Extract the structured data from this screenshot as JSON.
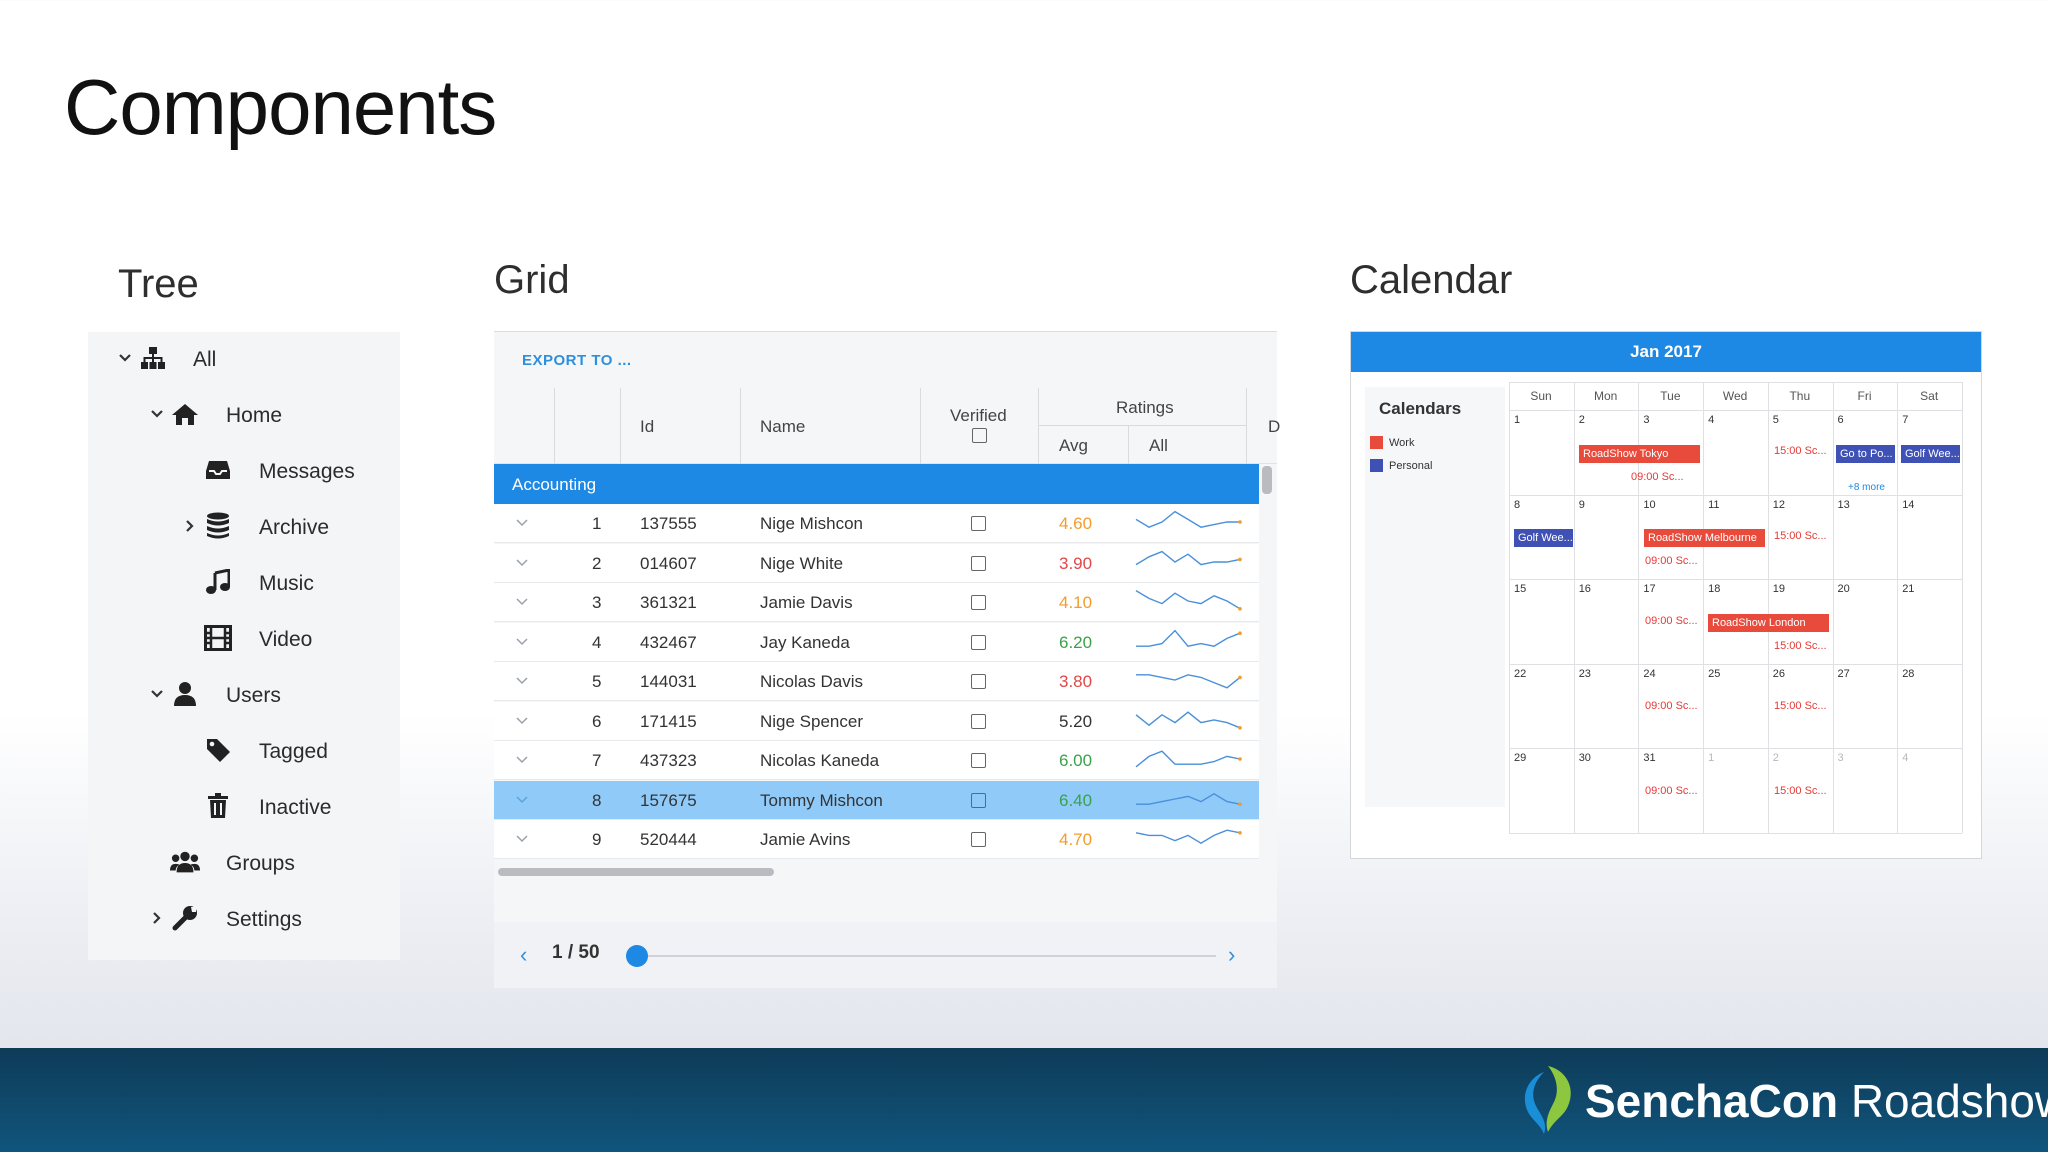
{
  "slide": {
    "title": "Components"
  },
  "sections": {
    "tree": "Tree",
    "grid": "Grid",
    "calendar": "Calendar"
  },
  "tree": {
    "nodes": [
      {
        "label": "All",
        "icon": "sitemap-icon",
        "expanded": true,
        "level": 0
      },
      {
        "label": "Home",
        "icon": "home-icon",
        "expanded": true,
        "level": 1
      },
      {
        "label": "Messages",
        "icon": "inbox-icon",
        "level": 2
      },
      {
        "label": "Archive",
        "icon": "database-icon",
        "collapsed": true,
        "level": 2
      },
      {
        "label": "Music",
        "icon": "music-icon",
        "level": 2
      },
      {
        "label": "Video",
        "icon": "film-icon",
        "level": 2
      },
      {
        "label": "Users",
        "icon": "user-icon",
        "expanded": true,
        "level": 1
      },
      {
        "label": "Tagged",
        "icon": "tag-icon",
        "level": 2
      },
      {
        "label": "Inactive",
        "icon": "trash-icon",
        "level": 2
      },
      {
        "label": "Groups",
        "icon": "users-icon",
        "level": 1
      },
      {
        "label": "Settings",
        "icon": "wrench-icon",
        "collapsed": true,
        "level": 1
      }
    ]
  },
  "grid": {
    "export_label": "EXPORT TO ...",
    "columns": {
      "id": "Id",
      "name": "Name",
      "verified": "Verified",
      "ratings": "Ratings",
      "avg": "Avg",
      "all": "All",
      "d": "D"
    },
    "group_label": "Accounting",
    "rows": [
      {
        "n": "1",
        "id": "137555",
        "name": "Nige Mishcon",
        "avg": "4.60",
        "color": "#f39c2b",
        "spark": [
          6,
          3,
          5,
          9,
          6,
          3,
          4,
          5,
          5
        ]
      },
      {
        "n": "2",
        "id": "014607",
        "name": "Nige White",
        "avg": "3.90",
        "color": "#e04848",
        "spark": [
          4,
          7,
          9,
          5,
          8,
          4,
          5,
          5,
          6
        ]
      },
      {
        "n": "3",
        "id": "361321",
        "name": "Jamie Davis",
        "avg": "4.10",
        "color": "#f39c2b",
        "spark": [
          9,
          6,
          4,
          8,
          5,
          4,
          7,
          5,
          2
        ]
      },
      {
        "n": "4",
        "id": "432467",
        "name": "Jay Kaneda",
        "avg": "6.20",
        "color": "#3aa248",
        "spark": [
          3,
          3,
          4,
          9,
          3,
          4,
          3,
          6,
          8
        ]
      },
      {
        "n": "5",
        "id": "144031",
        "name": "Nicolas Davis",
        "avg": "3.80",
        "color": "#e04848",
        "spark": [
          7,
          7,
          6,
          5,
          7,
          6,
          4,
          2,
          6
        ]
      },
      {
        "n": "6",
        "id": "171415",
        "name": "Nige Spencer",
        "avg": "5.20",
        "color": "#333333",
        "spark": [
          7,
          3,
          7,
          4,
          8,
          4,
          5,
          4,
          2
        ]
      },
      {
        "n": "7",
        "id": "437323",
        "name": "Nicolas Kaneda",
        "avg": "6.00",
        "color": "#3aa248",
        "spark": [
          2,
          6,
          8,
          3,
          3,
          3,
          4,
          6,
          5
        ]
      },
      {
        "n": "8",
        "id": "157675",
        "name": "Tommy Mishcon",
        "avg": "6.40",
        "color": "#3aa248",
        "selected": true,
        "spark": [
          3,
          3,
          4,
          5,
          6,
          4,
          7,
          4,
          3
        ]
      },
      {
        "n": "9",
        "id": "520444",
        "name": "Jamie Avins",
        "avg": "4.70",
        "color": "#f39c2b",
        "spark": [
          7,
          6,
          6,
          4,
          6,
          3,
          6,
          8,
          7
        ]
      }
    ],
    "pager": {
      "prev": "‹",
      "page": "1 / 50",
      "next": "›"
    }
  },
  "calendar": {
    "header": "Jan 2017",
    "sidebar_title": "Calendars",
    "calendars": [
      {
        "label": "Work",
        "color": "#e84b3c"
      },
      {
        "label": "Personal",
        "color": "#3f51b5"
      }
    ],
    "days_of_week": [
      "Sun",
      "Mon",
      "Tue",
      "Wed",
      "Thu",
      "Fri",
      "Sat"
    ],
    "weeks": [
      [
        "1",
        "2",
        "3",
        "4",
        "5",
        "6",
        "7"
      ],
      [
        "8",
        "9",
        "10",
        "11",
        "12",
        "13",
        "14"
      ],
      [
        "15",
        "16",
        "17",
        "18",
        "19",
        "20",
        "21"
      ],
      [
        "22",
        "23",
        "24",
        "25",
        "26",
        "27",
        "28"
      ],
      [
        "29",
        "30",
        "31",
        "1",
        "2",
        "3",
        "4"
      ]
    ],
    "events": {
      "roadshow_tokyo": "RoadShow Tokyo",
      "roadshow_melbourne": "RoadShow Melbourne",
      "roadshow_london": "RoadShow London",
      "go_to_po": "Go to Po...",
      "golf_wee": "Golf Wee...",
      "t0900": "09:00 Sc...",
      "t1500": "15:00 Sc...",
      "more": "+8 more"
    }
  },
  "footer": {
    "brand_bold": "SenchaCon",
    "brand_light": " Roadshow"
  }
}
